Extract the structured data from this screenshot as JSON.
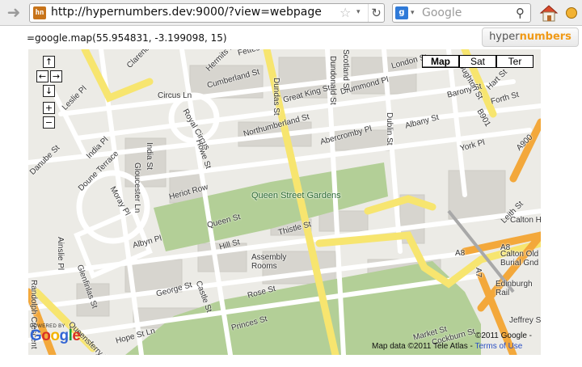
{
  "browser": {
    "url": "http://hypernumbers.dev:9000/?view=webpage",
    "favicon_text": "hn",
    "search_placeholder": "Google",
    "search_engine_glyph": "g",
    "icons": [
      "forward-arrow-icon",
      "star-icon",
      "reload-icon",
      "search-icon",
      "home-icon",
      "extension-icon"
    ]
  },
  "page": {
    "formula": "=google.map(55.954831, -3.199098, 15)",
    "brand_part1": "hyper",
    "brand_part2": "numbers"
  },
  "map": {
    "types": [
      "Map",
      "Sat",
      "Ter"
    ],
    "active_type": "Map",
    "nav": {
      "up": "↑",
      "left": "←",
      "right": "→",
      "down": "↓",
      "zoom_in": "+",
      "zoom_out": "−"
    },
    "powered_by": "POWERED BY",
    "logo": [
      "G",
      "o",
      "o",
      "g",
      "l",
      "e"
    ],
    "logo_colors": [
      "#3466d4",
      "#d93025",
      "#f3b300",
      "#3466d4",
      "#1e9e3a",
      "#d93025"
    ],
    "copyright": "©2011 Google -",
    "map_data": "Map data ©2011 Tele Atlas -",
    "terms": "Terms of Use",
    "colors": {
      "land": "#ecebe6",
      "park": "#b3cf97",
      "major_road": "#f7e56f",
      "arterial": "#f3a83b",
      "street": "#ffffff",
      "building": "#d7d5cf"
    },
    "labels": {
      "leslie_pl": "Leslie Pl",
      "circus_ln": "Circus Ln",
      "royal_circus": "Royal Circus",
      "cumberland_st": "Cumberland St",
      "great_king_st": "Great King St",
      "drummond_pl": "Drummond Pl",
      "london_st": "London St",
      "dundas_st": "Dundas St",
      "dublin_st": "Dublin St",
      "northumberland_st": "Northumberland St",
      "abercromby_pl": "Abercromby Pl",
      "albany_st": "Albany St",
      "york_pl": "York Pl",
      "forth_st": "Forth St",
      "barony_st": "Barony St",
      "hart_st": "Hart St",
      "b901": "B901",
      "india_pl": "India Pl",
      "india_st": "India St",
      "howe_st": "Howe St",
      "gloucester_ln": "Gloucester Ln",
      "doune_terrace": "Doune Terrace",
      "moray_pl": "Moray Pl",
      "danube_st": "Danube St",
      "heriot_row": "Heriot Row",
      "queen_street_gardens": "Queen Street Gardens",
      "queen_st": "Queen St",
      "thistle_st": "Thistle St",
      "hill_st": "Hill St",
      "albyn_pl": "Albyn Pl",
      "ainslie_pl": "Ainslie Pl",
      "glenfinlas_st": "Glenfinlas St",
      "assembly_rooms": "Assembly Rooms",
      "george_st": "George St",
      "castle_st": "Castle St",
      "rose_st": "Rose St",
      "princes_st": "Princes St",
      "hope_st_ln": "Hope St Ln",
      "queensferry_st": "Queensferry St",
      "market_st": "Market St",
      "cockburn_st": "Cockburn St",
      "leith_st": "Leith St",
      "a8": "A8",
      "a7": "A7",
      "a900": "A900",
      "calton_hill": "Calton Hill",
      "calton_old_burial_gnd": "Calton Old Burial Gnd",
      "edinburgh_rail": "Edinburgh Rail",
      "jeffrey_st": "Jeffrey St",
      "fettes_row": "Fettes Row",
      "dundonald_st": "Dundonald St",
      "scotland_st": "Scotland St",
      "broughton_st": "Broughton St",
      "randolph_crescent": "Randolph Crescent",
      "hermits_row": "Hermits Row",
      "clarence_st": "Clarence St"
    }
  }
}
